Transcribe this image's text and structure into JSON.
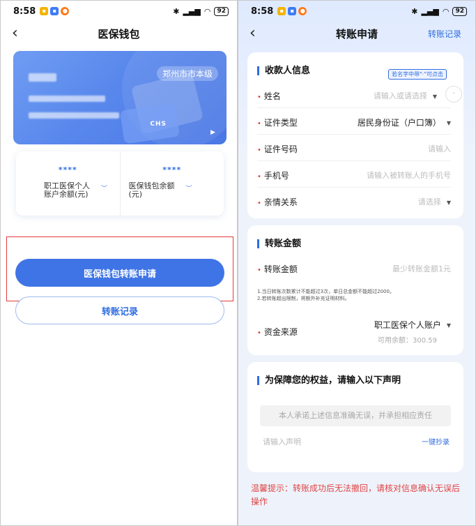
{
  "status_bar": {
    "time": "8:58",
    "battery": "92"
  },
  "left_screen": {
    "title": "医保钱包",
    "card": {
      "region_tag": "郑州市市本级",
      "logo_text": "CHS"
    },
    "balances": [
      {
        "masked": "****",
        "label_line1": "职工医保个人",
        "label_line2": "账户余额(元)"
      },
      {
        "masked": "****",
        "label_line1": "医保钱包余额",
        "label_line2": "(元)"
      }
    ],
    "primary_button": "医保钱包转账申请",
    "secondary_button": "转账记录"
  },
  "right_screen": {
    "title": "转账申请",
    "nav_right": "转账记录",
    "payee_section": {
      "title": "收款人信息",
      "hint_badge": "若名字中带\"·\"可点击",
      "fields": [
        {
          "label": "姓名",
          "value": "请输入或请选择",
          "placeholder": true
        },
        {
          "label": "证件类型",
          "value": "居民身份证（户口簿）",
          "placeholder": false
        },
        {
          "label": "证件号码",
          "value": "请输入",
          "placeholder": true
        },
        {
          "label": "手机号",
          "value": "请输入被转账人的手机号",
          "placeholder": true
        },
        {
          "label": "亲情关系",
          "value": "请选择",
          "placeholder": true
        }
      ]
    },
    "amount_section": {
      "title": "转账金额",
      "amount_label": "转账金额",
      "amount_placeholder": "最少转账金额1元",
      "note_1": "1.当日转账次数累计不能超过3次，单日总金额不能超过2000。",
      "note_2": "2.若转账超出限制，将额外补充证明材料。",
      "source_label": "资金来源",
      "source_value": "职工医保个人账户",
      "available": "可用余额：300.59"
    },
    "statement_section": {
      "title": "为保障您的权益，请输入以下声明",
      "statement_text": "本人承诺上述信息准确无误，并承担相应责任",
      "input_placeholder": "请输入声明",
      "copy_link": "一键抄录"
    },
    "warning": "温馨提示：转账成功后无法撤回，请核对信息确认无误后操作"
  }
}
